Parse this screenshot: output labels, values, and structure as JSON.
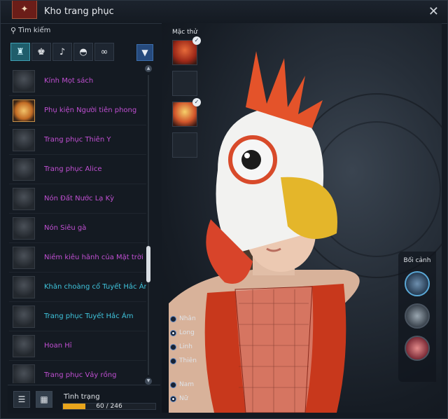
{
  "window": {
    "title": "Kho trang phục",
    "close_glyph": "✕"
  },
  "search": {
    "placeholder": "Tìm kiếm"
  },
  "categories": [
    {
      "icon": "outfit-icon",
      "glyph": "♜",
      "active": true
    },
    {
      "icon": "shirt-icon",
      "glyph": "♚",
      "active": false
    },
    {
      "icon": "accessory-icon",
      "glyph": "♪",
      "active": false
    },
    {
      "icon": "hat-icon",
      "glyph": "◓",
      "active": false
    },
    {
      "icon": "glasses-icon",
      "glyph": "∞",
      "active": false
    }
  ],
  "filter_glyph": "▼",
  "items": [
    {
      "label": "Kính Mọt sách",
      "color": "purple",
      "thumb": "grey"
    },
    {
      "label": "Phụ kiện Người tiên phong",
      "color": "purple",
      "thumb": "gold"
    },
    {
      "label": "Trang phục Thiên Y",
      "color": "purple",
      "thumb": "grey"
    },
    {
      "label": "Trang phục Alice",
      "color": "purple",
      "thumb": "grey"
    },
    {
      "label": "Nón Đất Nước Lạ Kỳ",
      "color": "purple",
      "thumb": "grey"
    },
    {
      "label": "Nón Siêu gà",
      "color": "purple",
      "thumb": "grey"
    },
    {
      "label": "Niềm kiêu hãnh của Mặt trời",
      "color": "purple",
      "thumb": "grey"
    },
    {
      "label": "Khăn choàng cổ Tuyết Hắc Ám",
      "color": "cyan",
      "thumb": "grey"
    },
    {
      "label": "Trang phục Tuyết Hắc Ám",
      "color": "cyan",
      "thumb": "grey"
    },
    {
      "label": "Hoan Hỉ",
      "color": "purple",
      "thumb": "grey"
    },
    {
      "label": "Trang phục Vảy rồng",
      "color": "purple",
      "thumb": "grey"
    }
  ],
  "bottom": {
    "list_view_glyph": "☰",
    "grid_view_glyph": "▦",
    "status_label": "Tình trạng",
    "progress_text": "60 / 246",
    "progress_fraction": 0.244
  },
  "preview": {
    "wearing_label": "Mặc thử",
    "slots": [
      {
        "kind": "outfit",
        "checked": true
      },
      {
        "kind": "empty",
        "checked": false
      },
      {
        "kind": "hat",
        "checked": true
      },
      {
        "kind": "empty",
        "checked": false
      }
    ],
    "races": [
      {
        "label": "Nhân",
        "selected": false
      },
      {
        "label": "Long",
        "selected": true
      },
      {
        "label": "Linh",
        "selected": false
      },
      {
        "label": "Thiên",
        "selected": false
      }
    ],
    "genders": [
      {
        "label": "Nam",
        "selected": false
      },
      {
        "label": "Nữ",
        "selected": true
      }
    ],
    "background_label": "Bối cảnh"
  }
}
